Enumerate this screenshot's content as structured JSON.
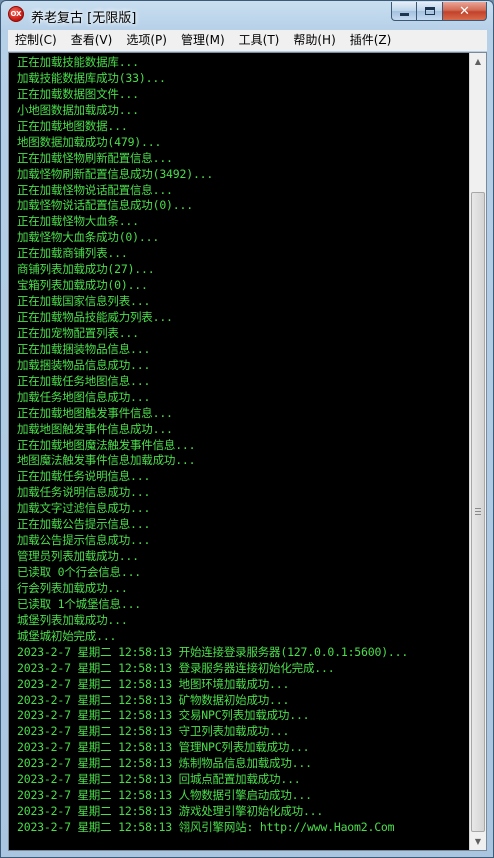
{
  "window": {
    "title": "养老复古 [无限版]",
    "icon_label": "OX",
    "icon": "app-red-circle-icon"
  },
  "caption": {
    "minimize_icon": "minimize-icon",
    "maximize_icon": "maximize-icon",
    "close_label": "✕"
  },
  "menu": [
    {
      "label": "控制(C)"
    },
    {
      "label": "查看(V)"
    },
    {
      "label": "选项(P)"
    },
    {
      "label": "管理(M)"
    },
    {
      "label": "工具(T)"
    },
    {
      "label": "帮助(H)"
    },
    {
      "label": "插件(Z)"
    }
  ],
  "log": [
    "正在加载技能数据库...",
    "加载技能数据库成功(33)...",
    "正在加载数据图文件...",
    "小地图数据加载成功...",
    "正在加载地图数据...",
    "地图数据加载成功(479)...",
    "正在加载怪物刷新配置信息...",
    "加载怪物刷新配置信息成功(3492)...",
    "正在加载怪物说话配置信息...",
    "加载怪物说话配置信息成功(0)...",
    "正在加载怪物大血条...",
    "加载怪物大血条成功(0)...",
    "正在加载商铺列表...",
    "商铺列表加载成功(27)...",
    "宝箱列表加载成功(0)...",
    "正在加载国家信息列表...",
    "正在加载物品技能威力列表...",
    "正在加宠物配置列表...",
    "正在加载捆装物品信息...",
    "加载捆装物品信息成功...",
    "正在加载任务地图信息...",
    "加载任务地图信息成功...",
    "正在加载地图触发事件信息...",
    "加载地图触发事件信息成功...",
    "正在加载地图魔法触发事件信息...",
    "地图魔法触发事件信息加载成功...",
    "正在加载任务说明信息...",
    "加载任务说明信息成功...",
    "加载文字过滤信息成功...",
    "正在加载公告提示信息...",
    "加载公告提示信息成功...",
    "管理员列表加载成功...",
    "已读取 0个行会信息...",
    "行会列表加载成功...",
    "已读取 1个城堡信息...",
    "城堡列表加载成功...",
    "城堡城初始完成...",
    "2023-2-7 星期二 12:58:13 开始连接登录服务器(127.0.0.1:5600)...",
    "2023-2-7 星期二 12:58:13 登录服务器连接初始化完成...",
    "2023-2-7 星期二 12:58:13 地图环境加载成功...",
    "2023-2-7 星期二 12:58:13 矿物数据初始成功...",
    "2023-2-7 星期二 12:58:13 交易NPC列表加载成功...",
    "2023-2-7 星期二 12:58:13 守卫列表加载成功...",
    "2023-2-7 星期二 12:58:13 管理NPC列表加载成功...",
    "2023-2-7 星期二 12:58:13 炼制物品信息加载成功...",
    "2023-2-7 星期二 12:58:13 回城点配置加载成功...",
    "2023-2-7 星期二 12:58:13 人物数据引擎启动成功...",
    "2023-2-7 星期二 12:58:13 游戏处理引擎初始化成功...",
    "2023-2-7 星期二 12:58:13 翎风引擎网站: http://www.Haom2.Com"
  ],
  "colors": {
    "console_bg": "#000000",
    "console_text": "#4bde4b"
  }
}
